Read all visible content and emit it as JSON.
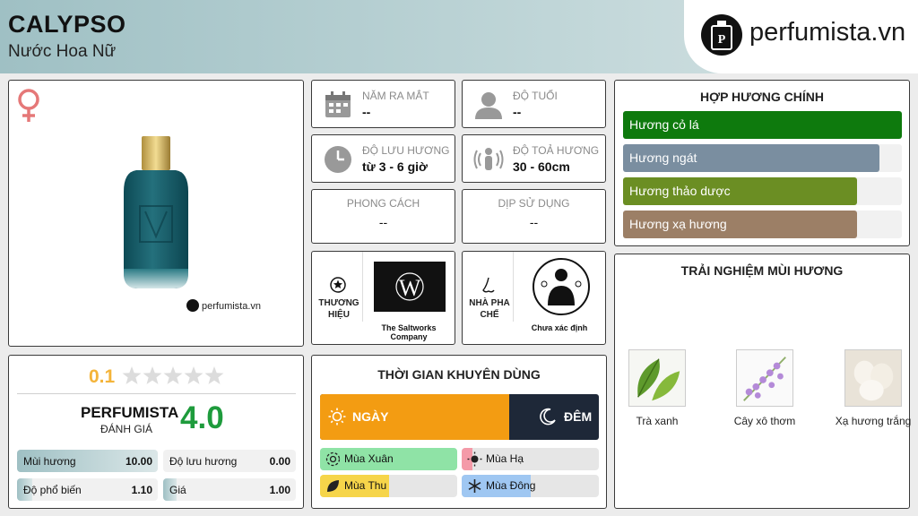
{
  "header": {
    "title": "CALYPSO",
    "subtitle": "Nước Hoa Nữ"
  },
  "logo": {
    "text": "perfumista.vn"
  },
  "product": {
    "gender_icon": "female-symbol-icon",
    "watermark": "perfumista.vn"
  },
  "info": {
    "release": {
      "label": "NĂM RA MẮT",
      "value": "--"
    },
    "age": {
      "label": "ĐỘ TUỔI",
      "value": "--"
    },
    "longevity": {
      "label": "ĐỘ LƯU HƯƠNG",
      "value": "từ 3 - 6 giờ"
    },
    "sillage": {
      "label": "ĐỘ TOẢ HƯƠNG",
      "value": "30 - 60cm"
    },
    "style": {
      "label": "PHONG CÁCH",
      "value": "--"
    },
    "occasion": {
      "label": "DỊP SỬ DỤNG",
      "value": "--"
    },
    "brand": {
      "label": "THƯƠNG HIỆU",
      "name": "The Saltworks Company"
    },
    "perfumer": {
      "label": "NHÀ PHA CHẾ",
      "name": "Chưa xác định"
    }
  },
  "accords": {
    "title": "HỢP HƯƠNG CHÍNH",
    "items": [
      {
        "label": "Hương cỏ lá",
        "level": 1.0,
        "color": "#0e7a0d"
      },
      {
        "label": "Hương ngát",
        "level": 0.92,
        "color": "#7a8ea0"
      },
      {
        "label": "Hương thảo dược",
        "level": 0.84,
        "color": "#6b8e23"
      },
      {
        "label": "Hương xạ hương",
        "level": 0.84,
        "color": "#9c7f66"
      }
    ]
  },
  "experience": {
    "title": "TRẢI NGHIỆM MÙI HƯƠNG",
    "notes": [
      {
        "label": "Trà xanh"
      },
      {
        "label": "Cây xô thơm"
      },
      {
        "label": "Xạ hương trắng"
      }
    ]
  },
  "rating": {
    "user_score": "0.1",
    "stars": 0.02,
    "brand": "PERFUMISTA",
    "brand_sub": "ĐÁNH GIÁ",
    "score": "4.0",
    "stats": [
      {
        "label": "Mùi hương",
        "value": "10.00",
        "level": 1.0
      },
      {
        "label": "Độ lưu hương",
        "value": "0.00",
        "level": 0.0
      },
      {
        "label": "Độ phổ biến",
        "value": "1.10",
        "level": 0.11
      },
      {
        "label": "Giá",
        "value": "1.00",
        "level": 0.1
      }
    ]
  },
  "time": {
    "title": "THỜI GIAN KHUYÊN DÙNG",
    "day": {
      "label": "NGÀY",
      "level": 0.68,
      "color": "#f39c12"
    },
    "night": {
      "label": "ĐÊM",
      "color": "#1e2838"
    },
    "seasons": [
      {
        "label": "Mùa Xuân",
        "level": 1.0,
        "color": "#8fe3a6"
      },
      {
        "label": "Mùa Hạ",
        "level": 0.08,
        "color": "#f49aa8"
      },
      {
        "label": "Mùa Thu",
        "level": 0.5,
        "color": "#f6d54a"
      },
      {
        "label": "Mùa Đông",
        "level": 0.5,
        "color": "#9fc7f2"
      }
    ]
  }
}
